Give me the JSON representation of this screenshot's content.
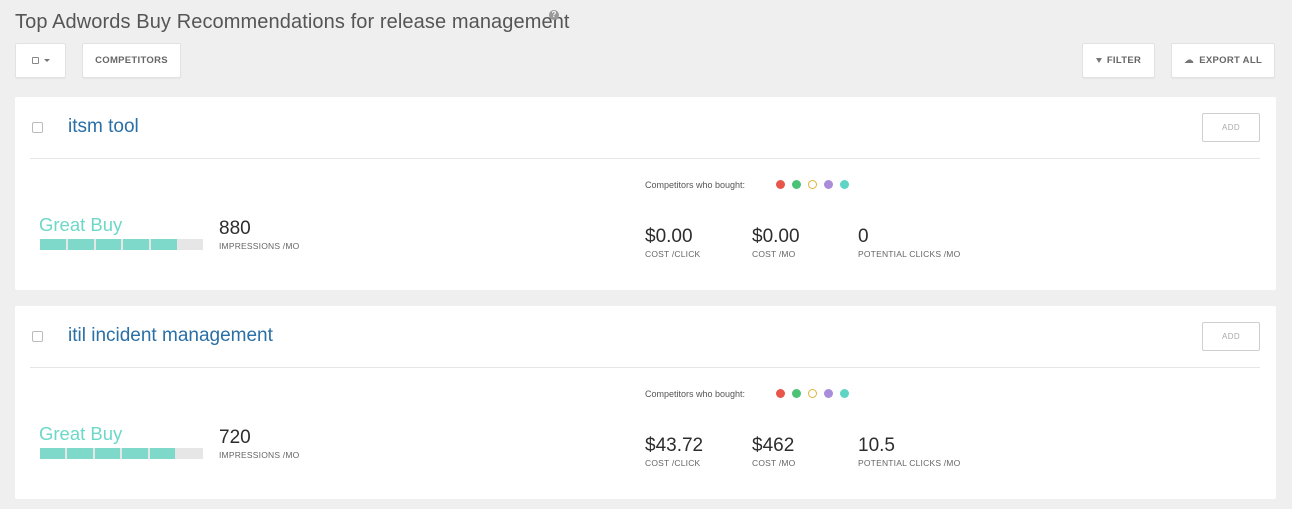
{
  "header": {
    "title": "Top Adwords Buy Recommendations for release management",
    "help_glyph": "?"
  },
  "toolbar": {
    "competitors_label": "COMPETITORS",
    "filter_label": "FILTER",
    "export_label": "EXPORT ALL"
  },
  "labels": {
    "add": "ADD",
    "competitors_bought": "Competitors who bought:",
    "impressions_unit": "IMPRESSIONS /MO",
    "cost_click_unit": "COST /CLICK",
    "cost_mo_unit": "COST /MO",
    "clicks_unit": "POTENTIAL CLICKS /MO"
  },
  "competitor_colors": [
    "#e8554a",
    "#4cc276",
    "#e2b33b",
    "#a98cda",
    "#5fd3c4"
  ],
  "cards": [
    {
      "keyword": "itsm tool",
      "rating": "Great Buy",
      "rating_fraction": 0.84,
      "impressions": "880",
      "cost_per_click": "$0.00",
      "cost_per_month": "$0.00",
      "potential_clicks": "0"
    },
    {
      "keyword": "itil incident management",
      "rating": "Great Buy",
      "rating_fraction": 0.83,
      "impressions": "720",
      "cost_per_click": "$43.72",
      "cost_per_month": "$462",
      "potential_clicks": "10.5"
    }
  ]
}
